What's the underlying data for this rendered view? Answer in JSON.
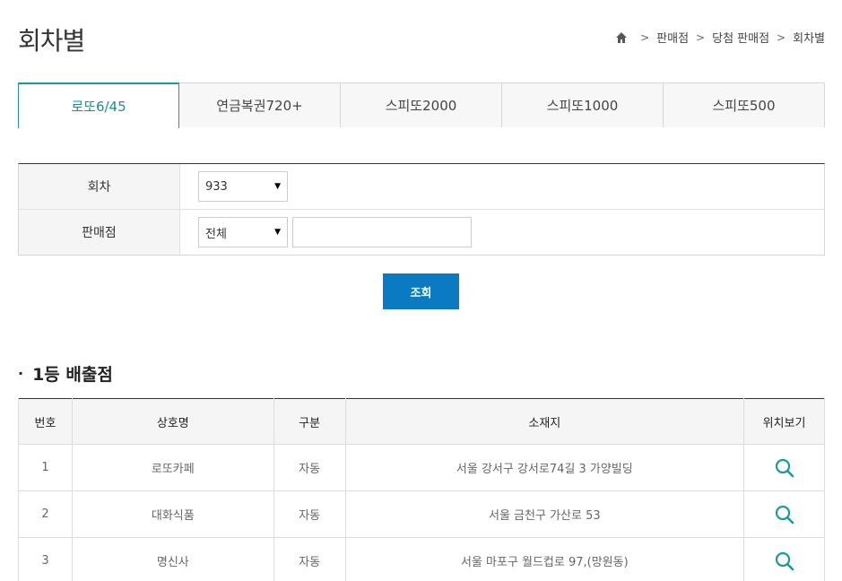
{
  "page": {
    "title": "회차별"
  },
  "breadcrumb": {
    "items": [
      "판매점",
      "당첨 판매점",
      "회차별"
    ]
  },
  "tabs": [
    {
      "label": "로또6/45",
      "active": true
    },
    {
      "label": "연금복권720+",
      "active": false
    },
    {
      "label": "스피또2000",
      "active": false
    },
    {
      "label": "스피또1000",
      "active": false
    },
    {
      "label": "스피또500",
      "active": false
    }
  ],
  "search": {
    "round_label": "회차",
    "round_value": "933",
    "store_label": "판매점",
    "store_value": "전체",
    "store_input_value": "",
    "button_label": "조회"
  },
  "section": {
    "title": "1등 배출점"
  },
  "table": {
    "headers": [
      "번호",
      "상호명",
      "구분",
      "소재지",
      "위치보기"
    ],
    "rows": [
      {
        "no": "1",
        "name": "로또카페",
        "type": "자동",
        "address": "서울 강서구 강서로74길 3 가양빌딩"
      },
      {
        "no": "2",
        "name": "대화식품",
        "type": "자동",
        "address": "서울 금천구 가산로 53"
      },
      {
        "no": "3",
        "name": "명신사",
        "type": "자동",
        "address": "서울 마포구 월드컵로 97,(망원동)"
      }
    ]
  },
  "colors": {
    "accent": "#1a9a9a",
    "button": "#0a7bc2"
  },
  "icons": {
    "home": "home-icon",
    "map": "search-icon"
  }
}
